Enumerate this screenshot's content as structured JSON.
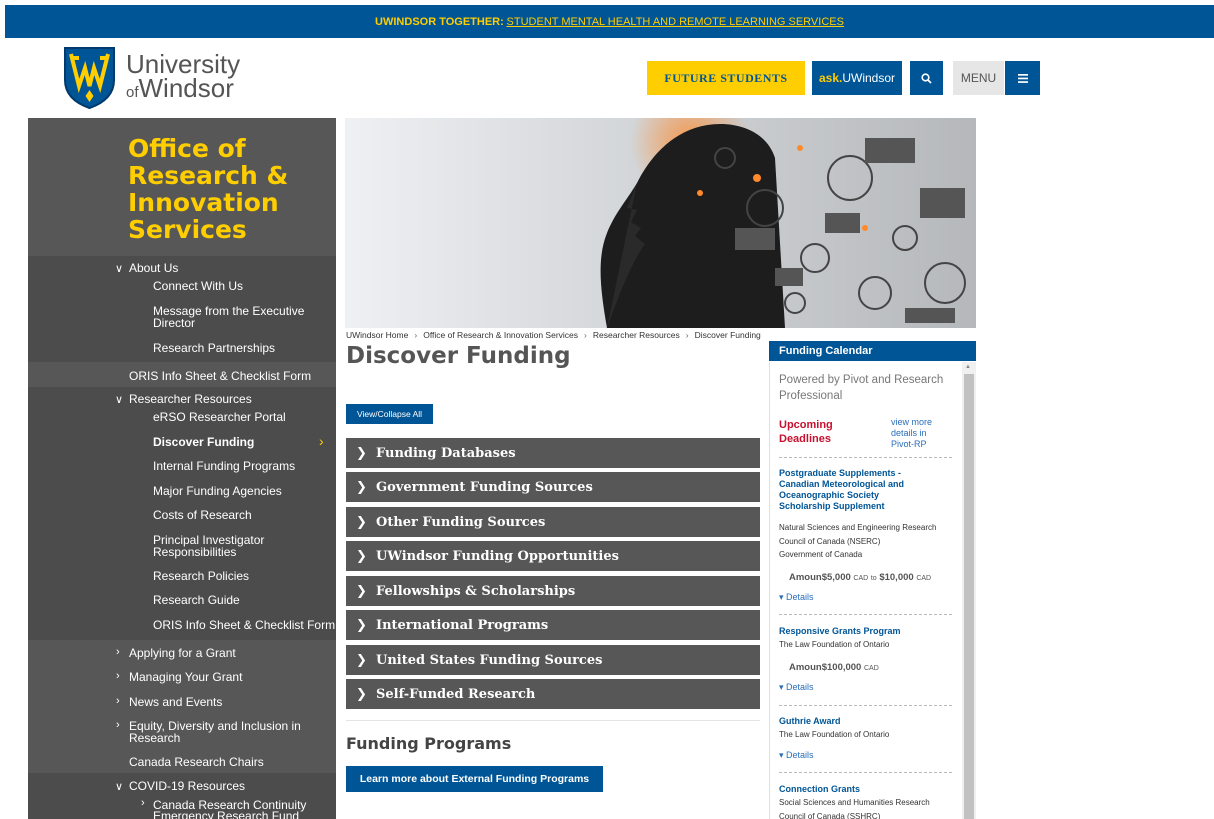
{
  "topbar": {
    "bold": "UWINDSOR TOGETHER:",
    "link": "STUDENT MENTAL HEALTH AND REMOTE LEARNING SERVICES"
  },
  "logo": {
    "line1": "University",
    "line2_prefix": "of",
    "line2": "Windsor"
  },
  "header": {
    "future_students": "FUTURE STUDENTS",
    "ask_prefix": "ask.",
    "ask_suffix": "UWindsor",
    "menu": "MENU"
  },
  "sidebar": {
    "title_lines": [
      "Office of",
      "Research &",
      "Innovation",
      "Services"
    ],
    "items": [
      {
        "label": "About Us"
      },
      {
        "label": "Connect With Us"
      },
      {
        "label": "Message from the Executive"
      },
      {
        "label": "Director"
      },
      {
        "label": "Research Partnerships"
      },
      {
        "label": "ORIS Info Sheet & Checklist Form"
      },
      {
        "label": "Researcher Resources"
      },
      {
        "label": "eRSO Researcher Portal"
      },
      {
        "label": "Discover Funding"
      },
      {
        "label": "Internal Funding Programs"
      },
      {
        "label": "Major Funding Agencies"
      },
      {
        "label": "Costs of Research"
      },
      {
        "label": "Principal Investigator"
      },
      {
        "label": "Responsibilities"
      },
      {
        "label": "Research Policies"
      },
      {
        "label": "Research Guide"
      },
      {
        "label": "ORIS Info Sheet & Checklist Form"
      },
      {
        "label": "Applying for a Grant"
      },
      {
        "label": "Managing Your Grant"
      },
      {
        "label": "News and Events"
      },
      {
        "label": "Equity, Diversity and Inclusion in"
      },
      {
        "label": "Research"
      },
      {
        "label": "Canada Research Chairs"
      },
      {
        "label": "COVID-19 Resources"
      },
      {
        "label": "Canada Research Continuity"
      },
      {
        "label": "Emergency Research Fund"
      }
    ]
  },
  "breadcrumb": [
    "UWindsor Home",
    "Office of Research & Innovation Services",
    "Researcher Resources",
    "Discover Funding"
  ],
  "main": {
    "title": "Discover Funding",
    "collapse_btn": "View/Collapse All",
    "accordions": [
      "Funding Databases",
      "Government Funding Sources",
      "Other Funding Sources",
      "UWindsor Funding Opportunities",
      "Fellowships & Scholarships",
      "International Programs",
      "United States Funding Sources",
      "Self-Funded Research"
    ],
    "programs_title": "Funding Programs",
    "learn_btn": "Learn more about External Funding Programs"
  },
  "calendar": {
    "title": "Funding Calendar",
    "powered": [
      "Powered by Pivot and Research",
      "Professional"
    ],
    "upcoming": [
      "Upcoming",
      "Deadlines"
    ],
    "view_more": [
      "view more",
      "details in",
      "Pivot-RP"
    ],
    "grants": [
      {
        "title": [
          "Postgraduate Supplements -",
          "Canadian Meteorological and",
          "Oceanographic Society",
          "Scholarship Supplement"
        ],
        "sponsor": [
          "Natural Sciences and Engineering Research",
          "Council of Canada (NSERC)",
          "Government of Canada"
        ],
        "amount_label": "Amoun",
        "amount": "$5,000",
        "currency1": "CAD",
        "to": "to",
        "amount2": "$10,000",
        "currency2": "CAD",
        "details": "Details"
      },
      {
        "title": [
          "Responsive Grants Program"
        ],
        "sponsor": [
          "The Law Foundation of Ontario"
        ],
        "amount_label": "Amoun",
        "amount": "$100,000",
        "currency1": "CAD",
        "details": "Details"
      },
      {
        "title": [
          "Guthrie Award"
        ],
        "sponsor": [
          "The Law Foundation of Ontario"
        ],
        "details": "Details"
      },
      {
        "title": [
          "Connection Grants"
        ],
        "sponsor": [
          "Social Sciences and Humanities Research",
          "Council of Canada (SSHRC)"
        ]
      }
    ]
  },
  "colors": {
    "brand_blue": "#005596",
    "brand_gold": "#ffce00",
    "sidebar_gray": "#575757"
  }
}
